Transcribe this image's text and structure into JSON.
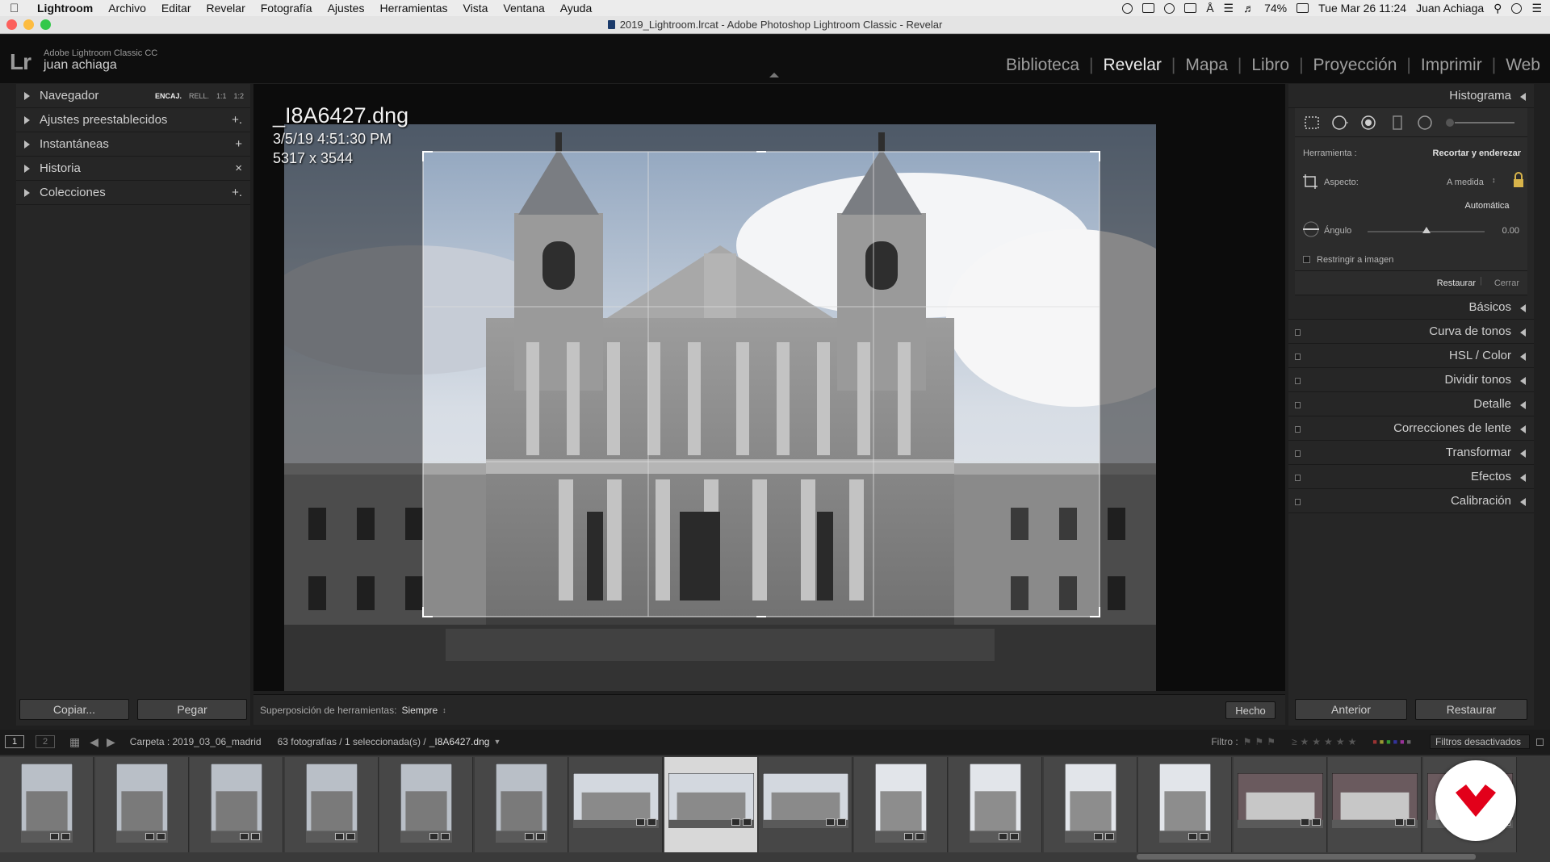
{
  "menubar": {
    "app_name": "Lightroom",
    "items": [
      "Archivo",
      "Editar",
      "Revelar",
      "Fotografía",
      "Ajustes",
      "Herramientas",
      "Vista",
      "Ventana",
      "Ayuda"
    ],
    "battery": "74%",
    "clock": "Tue Mar 26  11:24",
    "user": "Juan Achiaga"
  },
  "window": {
    "title": "2019_Lightroom.lrcat - Adobe Photoshop Lightroom Classic - Revelar"
  },
  "identity": {
    "product": "Adobe Lightroom Classic CC",
    "user": "juan achiaga",
    "logo": "Lr"
  },
  "modules": {
    "items": [
      "Biblioteca",
      "Revelar",
      "Mapa",
      "Libro",
      "Proyección",
      "Imprimir",
      "Web"
    ],
    "active": "Revelar"
  },
  "left_panel": {
    "navigator": {
      "label": "Navegador",
      "opts": [
        "ENCAJ.",
        "RELL.",
        "1:1",
        "1:2"
      ]
    },
    "presets": {
      "label": "Ajustes preestablecidos",
      "action": "+."
    },
    "snapshots": {
      "label": "Instantáneas",
      "action": "+"
    },
    "history": {
      "label": "Historia",
      "action": "×"
    },
    "collections": {
      "label": "Colecciones",
      "action": "+."
    },
    "copy": "Copiar...",
    "paste": "Pegar"
  },
  "photo_info": {
    "filename": "_I8A6427.dng",
    "datetime": "3/5/19 4:51:30 PM",
    "dimensions": "5317 x 3544"
  },
  "toolbar": {
    "overlay_label": "Superposición de herramientas:",
    "overlay_value": "Siempre",
    "done": "Hecho"
  },
  "right_panel": {
    "histogram": "Histograma",
    "crop": {
      "tool_label": "Herramienta :",
      "tool_name": "Recortar y enderezar",
      "aspect_label": "Aspecto:",
      "aspect_value": "A medida",
      "auto": "Automática",
      "angle_label": "Ángulo",
      "angle_value": "0.00",
      "constrain": "Restringir a imagen",
      "reset": "Restaurar",
      "close": "Cerrar",
      "angle_slider": 0.5
    },
    "sections": [
      "Básicos",
      "Curva de tonos",
      "HSL / Color",
      "Dividir tonos",
      "Detalle",
      "Correcciones de lente",
      "Transformar",
      "Efectos",
      "Calibración"
    ],
    "previous": "Anterior",
    "reset": "Restaurar"
  },
  "filmbar": {
    "view1": "1",
    "view2": "2",
    "folder": "Carpeta : 2019_03_06_madrid",
    "count": "63 fotografías / 1 seleccionada(s) /",
    "current": "_I8A6427.dng",
    "filter_label": "Filtro :",
    "filter_value": "Filtros desactivados"
  },
  "colors": {
    "panel": "#262626",
    "background": "#0c0c0c",
    "accent": "#cfcfcf",
    "brand": "#e2001a"
  }
}
